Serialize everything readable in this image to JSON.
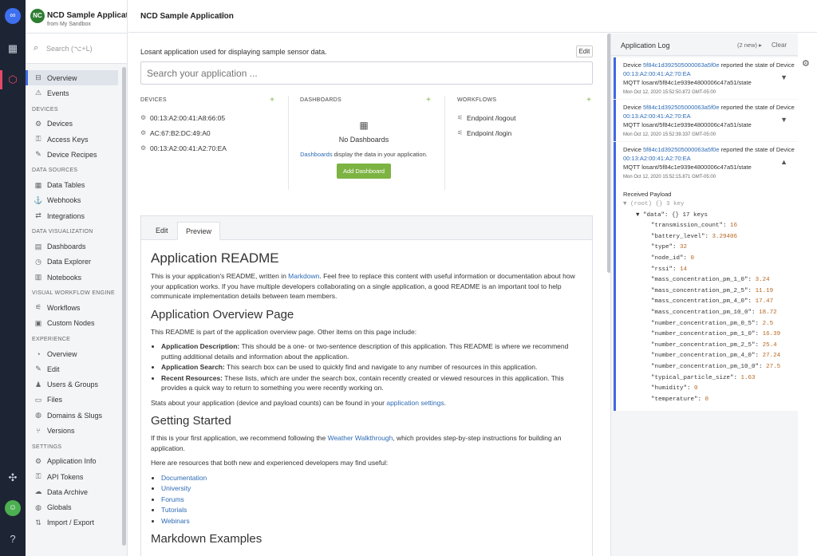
{
  "rail": {
    "logo_icon": "losant-logo-icon",
    "items": [
      "dashboard-icon",
      "application-cube-icon"
    ],
    "bottom": [
      "network-icon",
      "avatar-icon",
      "help-icon"
    ]
  },
  "app": {
    "avatar": "NC",
    "name": "NCD Sample Application",
    "subtitle": "from My Sandbox"
  },
  "sidebar": {
    "search_placeholder": "Search (⌥+L)",
    "top": [
      {
        "label": "Overview",
        "icon": "⊟"
      },
      {
        "label": "Events",
        "icon": "⚠"
      }
    ],
    "sections": [
      {
        "title": "DEVICES",
        "items": [
          {
            "label": "Devices",
            "icon": "⚙"
          },
          {
            "label": "Access Keys",
            "icon": "⚿"
          },
          {
            "label": "Device Recipes",
            "icon": "✎"
          }
        ]
      },
      {
        "title": "DATA SOURCES",
        "items": [
          {
            "label": "Data Tables",
            "icon": "▦"
          },
          {
            "label": "Webhooks",
            "icon": "⚓"
          },
          {
            "label": "Integrations",
            "icon": "⇄"
          }
        ]
      },
      {
        "title": "DATA VISUALIZATION",
        "items": [
          {
            "label": "Dashboards",
            "icon": "▤"
          },
          {
            "label": "Data Explorer",
            "icon": "◷"
          },
          {
            "label": "Notebooks",
            "icon": "▥"
          }
        ]
      },
      {
        "title": "VISUAL WORKFLOW ENGINE",
        "items": [
          {
            "label": "Workflows",
            "icon": "⚟"
          },
          {
            "label": "Custom Nodes",
            "icon": "▣"
          }
        ]
      },
      {
        "title": "EXPERIENCE",
        "items": [
          {
            "label": "Overview",
            "icon": "◔"
          },
          {
            "label": "Edit",
            "icon": "✎"
          },
          {
            "label": "Users & Groups",
            "icon": "♟"
          },
          {
            "label": "Files",
            "icon": "▭"
          },
          {
            "label": "Domains & Slugs",
            "icon": "◍"
          },
          {
            "label": "Versions",
            "icon": "⑂"
          }
        ]
      },
      {
        "title": "SETTINGS",
        "items": [
          {
            "label": "Application Info",
            "icon": "⚙"
          },
          {
            "label": "API Tokens",
            "icon": "⚿"
          },
          {
            "label": "Data Archive",
            "icon": "☁"
          },
          {
            "label": "Globals",
            "icon": "◍"
          },
          {
            "label": "Import / Export",
            "icon": "⇅"
          }
        ]
      }
    ]
  },
  "header": {
    "title": "NCD Sample Application"
  },
  "main": {
    "description": "Losant application used for displaying sample sensor data.",
    "edit_label": "Edit",
    "search_placeholder": "Search your application ...",
    "devices": {
      "title": "DEVICES",
      "items": [
        "00:13:A2:00:41:A8:66:05",
        "AC:67:B2:DC:49:A0",
        "00:13:A2:00:41:A2:70:EA"
      ]
    },
    "dashboards": {
      "title": "DASHBOARDS",
      "empty_title": "No Dashboards",
      "empty_link": "Dashboards",
      "empty_text": " display the data in your application.",
      "button": "Add Dashboard"
    },
    "workflows": {
      "title": "WORKFLOWS",
      "items": [
        "Endpoint /logout",
        "Endpoint /login"
      ]
    }
  },
  "readme": {
    "tab_edit": "Edit",
    "tab_preview": "Preview",
    "h1": "Application README",
    "p1a": "This is your application's README, written in ",
    "p1_link": "Markdown",
    "p1b": ". Feel free to replace this content with useful information or documentation about how your application works. If you have multiple developers collaborating on a single application, a good README is an important tool to help communicate implementation details between team members.",
    "h2a": "Application Overview Page",
    "p2": "This README is part of the application overview page. Other items on this page include:",
    "bullets": [
      {
        "b": "Application Description:",
        "t": " This should be a one- or two-sentence description of this application. This README is where we recommend putting additional details and information about the application."
      },
      {
        "b": "Application Search:",
        "t": " This search box can be used to quickly find and navigate to any number of resources in this application."
      },
      {
        "b": "Recent Resources:",
        "t": " These lists, which are under the search box, contain recently created or viewed resources in this application. This provides a quick way to return to something you were recently working on."
      }
    ],
    "p3a": "Stats about your application (device and payload counts) can be found in your ",
    "p3_link": "application settings",
    "p3b": ".",
    "h2b": "Getting Started",
    "p4a": "If this is your first application, we recommend following the ",
    "p4_link": "Weather Walkthrough",
    "p4b": ", which provides step-by-step instructions for building an application.",
    "p5": "Here are resources that both new and experienced developers may find useful:",
    "links": [
      "Documentation",
      "University",
      "Forums",
      "Tutorials",
      "Webinars"
    ],
    "h2c": "Markdown Examples"
  },
  "log": {
    "title": "Application Log",
    "new_count": "(2 new)",
    "clear": "Clear",
    "entries": [
      {
        "pre": "Device ",
        "id": "5f84c1d392505000063a5f0e",
        "mid": " reported the state of Device ",
        "name": "00:13:A2:00:41:A2:70:EA",
        "topic": "MQTT losant/5f84c1e939e4800006c47a51/state",
        "time": "Mon Oct 12, 2020 15:52:50.872 GMT-05:00"
      },
      {
        "pre": "Device ",
        "id": "5f84c1d392505000063a5f0e",
        "mid": " reported the state of Device ",
        "name": "00:13:A2:00:41:A2:70:EA",
        "topic": "MQTT losant/5f84c1e939e4800006c47a51/state",
        "time": "Mon Oct 12, 2020 15:52:39.337 GMT-05:00"
      },
      {
        "pre": "Device ",
        "id": "5f84c1d392505000063a5f0e",
        "mid": " reported the state of Device ",
        "name": "00:13:A2:00:41:A2:70:EA",
        "topic": "MQTT losant/5f84c1e939e4800006c47a51/state",
        "time": "Mon Oct 12, 2020 15:52:15.871 GMT-05:00"
      }
    ],
    "payload_title": "Received Payload",
    "root_label": "▼ (root)  {}  3 key",
    "data_label": "▼ \"data\":  {}  17 keys",
    "fields": [
      {
        "k": "transmission_count",
        "v": "16"
      },
      {
        "k": "battery_level",
        "v": "3.29406"
      },
      {
        "k": "type",
        "v": "32"
      },
      {
        "k": "node_id",
        "v": "0"
      },
      {
        "k": "rssi",
        "v": "14"
      },
      {
        "k": "mass_concentration_pm_1_0",
        "v": "3.24"
      },
      {
        "k": "mass_concentration_pm_2_5",
        "v": "11.19"
      },
      {
        "k": "mass_concentration_pm_4_0",
        "v": "17.47"
      },
      {
        "k": "mass_concentration_pm_10_0",
        "v": "18.72"
      },
      {
        "k": "number_concentration_pm_0_5",
        "v": "2.5"
      },
      {
        "k": "number_concentration_pm_1_0",
        "v": "16.39"
      },
      {
        "k": "number_concentration_pm_2_5",
        "v": "25.4"
      },
      {
        "k": "number_concentration_pm_4_0",
        "v": "27.24"
      },
      {
        "k": "number_concentration_pm_10_0",
        "v": "27.5"
      },
      {
        "k": "typical_particle_size",
        "v": "1.63"
      },
      {
        "k": "humidity",
        "v": "0"
      },
      {
        "k": "temperature",
        "v": "0"
      }
    ]
  }
}
